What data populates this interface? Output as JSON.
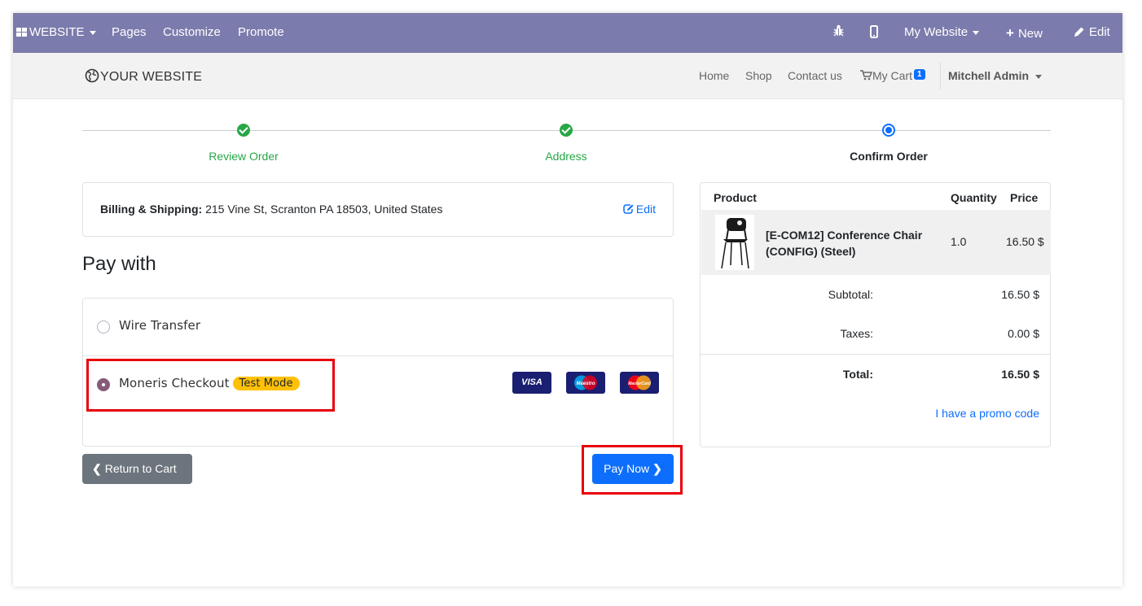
{
  "adminbar": {
    "website_label": "WEBSITE",
    "pages": "Pages",
    "customize": "Customize",
    "promote": "Promote",
    "my_website": "My Website",
    "new": "New",
    "edit": "Edit",
    "bg_color": "#7c7bad"
  },
  "header": {
    "logo_text": "YOUR WEBSITE",
    "nav": {
      "home": "Home",
      "shop": "Shop",
      "contact": "Contact us",
      "cart": "My Cart",
      "cart_count": "1"
    },
    "user": "Mitchell Admin"
  },
  "wizard": {
    "steps": [
      {
        "label": "Review Order",
        "state": "done"
      },
      {
        "label": "Address",
        "state": "done"
      },
      {
        "label": "Confirm Order",
        "state": "active"
      }
    ]
  },
  "billing": {
    "label": "Billing & Shipping:",
    "address": "215 Vine St, Scranton PA 18503, United States",
    "edit": "Edit"
  },
  "payment": {
    "title": "Pay with",
    "options": [
      {
        "label": "Wire Transfer",
        "selected": false
      },
      {
        "label": "Moneris Checkout",
        "selected": true,
        "badge": "Test Mode",
        "icons": [
          "visa-icon",
          "maestro-icon",
          "mastercard-icon"
        ]
      }
    ],
    "visa": "VISA",
    "maestro": "Maestro",
    "mastercard": "MasterCard",
    "return_button": "Return to Cart",
    "pay_button": "Pay Now"
  },
  "summary": {
    "col_product": "Product",
    "col_quantity": "Quantity",
    "col_price": "Price",
    "product_name_line1": "[E-COM12] Conference Chair",
    "product_name_line2": "(CONFIG) (Steel)",
    "product_qty": "1.0",
    "product_price": "16.50 $",
    "subtotal_label": "Subtotal:",
    "subtotal": "16.50 $",
    "taxes_label": "Taxes:",
    "taxes": "0.00 $",
    "total_label": "Total:",
    "total": "16.50 $",
    "promo": "I have a promo code"
  },
  "colors": {
    "accent_blue": "#0d6efd",
    "success_green": "#28a745",
    "brand_purple": "#875a7b",
    "highlight_red": "#e8000b"
  }
}
